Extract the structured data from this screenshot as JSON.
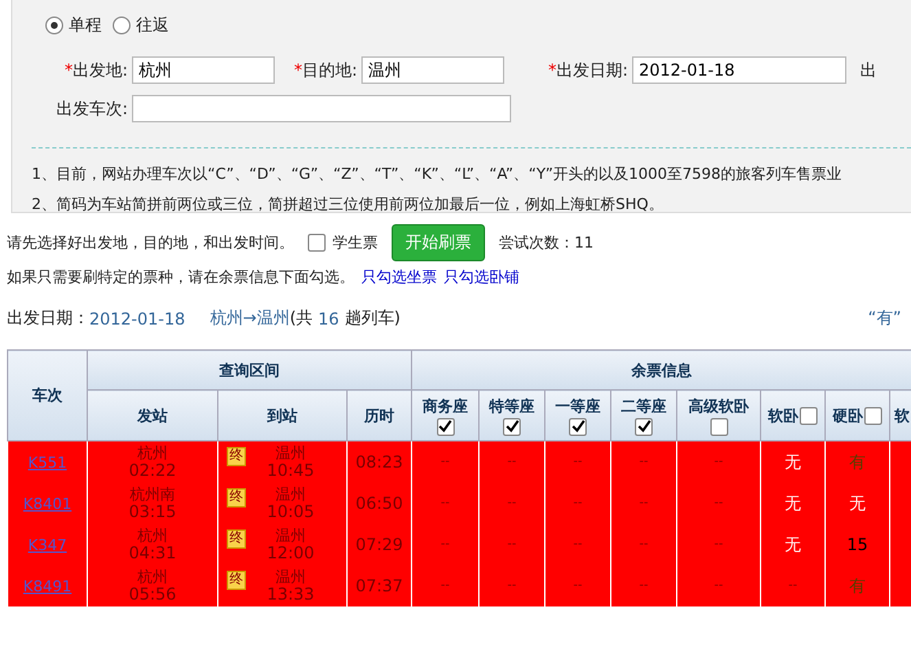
{
  "trip_type": [
    {
      "label": "单程",
      "selected": true
    },
    {
      "label": "往返",
      "selected": false
    }
  ],
  "fields": [
    {
      "mark": "*",
      "label": "出发地:",
      "value": "杭州"
    },
    {
      "mark": "*",
      "label": "目的地:",
      "value": "温州"
    },
    {
      "mark": "*",
      "label": "出发日期:",
      "value": "2012-01-18"
    }
  ],
  "cut_label": "出",
  "train_field": {
    "label": "出发车次:"
  },
  "notes": [
    "1、目前，网站办理车次以“C”、“D”、“G”、“Z”、“T”、“K”、“L”、“A”、“Y”开头的以及1000至7598的旅客列车售票业",
    "2、简码为车站简拼前两位或三位，简拼超过三位使用前两位加最后一位，例如上海虹桥SHQ。"
  ],
  "hint": "请先选择好出发地，目的地，和出发时间。",
  "student": {
    "label": "学生票",
    "checked": false
  },
  "start_button": "开始刷票",
  "attempts": "尝试次数：11",
  "filter_hint": "如果只需要刷特定的票种，请在余票信息下面勾选。",
  "filter_links": [
    "只勾选坐票",
    "只勾选卧铺"
  ],
  "summary": {
    "label": "出发日期：",
    "date": "2012-01-18",
    "route": "杭州→温州",
    "count_pre": "(共",
    "count": "16",
    "count_post": "趟列车)",
    "legend": "“有”"
  },
  "table": {
    "train_header": "车次",
    "range_header": "查询区间",
    "range_columns": [
      "发站",
      "到站",
      "历时"
    ],
    "seats_header": "余票信息",
    "seat_columns": [
      {
        "label": "商务座",
        "kind": "below",
        "checked": true
      },
      {
        "label": "特等座",
        "kind": "below",
        "checked": true
      },
      {
        "label": "一等座",
        "kind": "below",
        "checked": true
      },
      {
        "label": "二等座",
        "kind": "below",
        "checked": true
      },
      {
        "label": "高级软卧",
        "kind": "below",
        "checked": false
      },
      {
        "label": "软卧",
        "kind": "inline",
        "checked": false
      },
      {
        "label": "硬卧",
        "kind": "inline",
        "checked": false
      },
      {
        "label": "软",
        "kind": "plain"
      }
    ],
    "rows": [
      {
        "train": "K551",
        "highlighted": true,
        "from": "杭州",
        "dep": "02:22",
        "badge": "终",
        "to": "温州",
        "arr": "10:45",
        "duration": "08:23",
        "seats": [
          {
            "text": "--",
            "kind": "na"
          },
          {
            "text": "--",
            "kind": "na"
          },
          {
            "text": "--",
            "kind": "na"
          },
          {
            "text": "--",
            "kind": "na"
          },
          {
            "text": "--",
            "kind": "na"
          },
          {
            "text": "无",
            "kind": "none"
          },
          {
            "text": "有",
            "kind": "available"
          }
        ]
      },
      {
        "train": "K8401",
        "highlighted": true,
        "from": "杭州南",
        "dep": "03:15",
        "badge": "终",
        "to": "温州",
        "arr": "10:05",
        "duration": "06:50",
        "seats": [
          {
            "text": "--",
            "kind": "na"
          },
          {
            "text": "--",
            "kind": "na"
          },
          {
            "text": "--",
            "kind": "na"
          },
          {
            "text": "--",
            "kind": "na"
          },
          {
            "text": "--",
            "kind": "na"
          },
          {
            "text": "无",
            "kind": "none"
          },
          {
            "text": "无",
            "kind": "none"
          }
        ]
      },
      {
        "train": "K347",
        "highlighted": true,
        "from": "杭州",
        "dep": "04:31",
        "badge": "终",
        "to": "温州",
        "arr": "12:00",
        "duration": "07:29",
        "seats": [
          {
            "text": "--",
            "kind": "na"
          },
          {
            "text": "--",
            "kind": "na"
          },
          {
            "text": "--",
            "kind": "na"
          },
          {
            "text": "--",
            "kind": "na"
          },
          {
            "text": "--",
            "kind": "na"
          },
          {
            "text": "无",
            "kind": "none"
          },
          {
            "text": "15",
            "kind": "count"
          }
        ]
      },
      {
        "train": "K8491",
        "highlighted": true,
        "from": "杭州",
        "dep": "05:56",
        "badge": "终",
        "to": "温州",
        "arr": "13:33",
        "duration": "07:37",
        "seats": [
          {
            "text": "--",
            "kind": "na"
          },
          {
            "text": "--",
            "kind": "na"
          },
          {
            "text": "--",
            "kind": "na"
          },
          {
            "text": "--",
            "kind": "na"
          },
          {
            "text": "--",
            "kind": "na"
          },
          {
            "text": "--",
            "kind": "na"
          },
          {
            "text": "有",
            "kind": "available"
          }
        ]
      }
    ]
  }
}
